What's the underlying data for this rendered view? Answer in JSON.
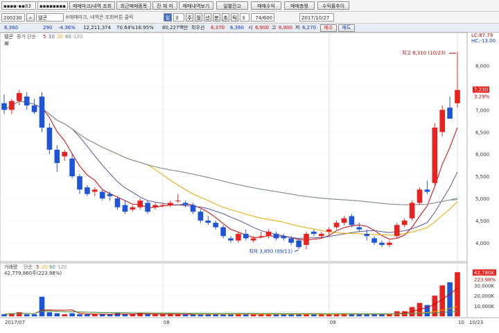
{
  "toolbar": {
    "account": "▪▪▪▪-▪▪83",
    "password": "▪▪▪▪▪▪▪▪",
    "buy_sell_btn": "매매마크/내역 조회",
    "recent_btn": "최근매매종목",
    "balance_btn": "잔 체 미",
    "history_btn": "매매내역보기",
    "daily_balance_btn": "일별잔고",
    "profit_btn": "매매수익",
    "trade_amount_btn": "매매총평",
    "yield_btn": "수익률추이"
  },
  "toolbar2": {
    "code": "200230",
    "search_icon": "search-icon",
    "stock_name": "텔콘",
    "hint": "※매매마크, 내역은 조회버튼 클릭",
    "period_select": "일",
    "period_value": "3",
    "periods": [
      "주",
      "월",
      "년",
      "분",
      "초",
      "틱"
    ],
    "interval": "3",
    "count": "74/600",
    "date": "2017/10/27"
  },
  "quote": {
    "price": "6,360",
    "change": "290",
    "change_pct": "-4.36%",
    "volume": "12,211,374",
    "vol_ratio": "70.64%",
    "turnover": "16.95%",
    "amount": "80,227백만",
    "broker": "최우선",
    "open_label": "6,370",
    "bid": "6,360",
    "open_tag": "시",
    "open": "6,900",
    "high_tag": "고",
    "high": "6,900",
    "low_tag": "저",
    "low": "6,270",
    "buy_btn": "매수",
    "sell_btn": "매도"
  },
  "price_panel": {
    "legend_name": "텔콘",
    "legend_ma": "종가 단순",
    "ma_periods": [
      "5",
      "10",
      "20",
      "60",
      "120"
    ],
    "ma_colors": [
      "#cc0000",
      "#555599",
      "#e8a800",
      "#3c8d5c",
      "#8f8f8f"
    ],
    "lc_label": "LC:87.79",
    "hc_label": "HC:-13.00",
    "high_annotation": "최고 8,310 (10/23)",
    "low_annotation": "최저 3,850 (09/11)",
    "current_price_tag": "7,230",
    "current_pct_tag": "3.29%",
    "y_ticks": [
      "8,000",
      "7,500",
      "7,000",
      "6,500",
      "6,000",
      "5,500",
      "5,000",
      "4,500",
      "4,000"
    ]
  },
  "volume_panel": {
    "legend_name": "거래량",
    "legend_ma": "단순",
    "ma_periods": [
      "5",
      "20",
      "60",
      "120"
    ],
    "value_text": "42,779,860주(223.98%)",
    "current_tag": "42,780K",
    "current_pct": "223.98%",
    "y_ticks": [
      "30,000K",
      "20,000K",
      "10,000K"
    ]
  },
  "x_axis": {
    "labels": [
      "2017/07",
      "08",
      "09",
      "10",
      "10/23"
    ]
  },
  "chart_data": {
    "type": "candlestick",
    "title": "텔콘",
    "x": [
      "2017/07",
      "08",
      "09",
      "10",
      "10/23"
    ],
    "ylim": [
      3700,
      8400
    ],
    "ohlc": [
      [
        7150,
        7350,
        6900,
        7000
      ],
      [
        7000,
        7250,
        6900,
        7200
      ],
      [
        7200,
        7450,
        7100,
        7380
      ],
      [
        7300,
        7400,
        7000,
        7100
      ],
      [
        7100,
        7250,
        6900,
        6950
      ],
      [
        7300,
        7400,
        6500,
        6600
      ],
      [
        6600,
        6700,
        6000,
        6100
      ],
      [
        6100,
        6200,
        5600,
        5800
      ],
      [
        5950,
        6100,
        5850,
        6050
      ],
      [
        5900,
        6000,
        5450,
        5500
      ],
      [
        5500,
        5550,
        5100,
        5200
      ],
      [
        5250,
        5300,
        5050,
        5100
      ],
      [
        5150,
        5250,
        5050,
        5200
      ],
      [
        5150,
        5200,
        4950,
        5000
      ],
      [
        5100,
        5150,
        4950,
        5050
      ],
      [
        5000,
        5050,
        4750,
        4800
      ],
      [
        4850,
        4950,
        4650,
        4700
      ],
      [
        4750,
        4850,
        4700,
        4800
      ],
      [
        4800,
        5000,
        4750,
        4950
      ],
      [
        4900,
        4950,
        4650,
        4700
      ],
      [
        4800,
        4900,
        4750,
        4850
      ],
      [
        4850,
        4900,
        4800,
        4850
      ],
      [
        4850,
        4950,
        4800,
        4900
      ],
      [
        4950,
        5100,
        4900,
        4950
      ],
      [
        4900,
        4950,
        4800,
        4850
      ],
      [
        4850,
        4900,
        4650,
        4700
      ],
      [
        4700,
        4750,
        4450,
        4500
      ],
      [
        4500,
        4600,
        4400,
        4450
      ],
      [
        4450,
        4500,
        4300,
        4350
      ],
      [
        4350,
        4400,
        4100,
        4150
      ],
      [
        4100,
        4150,
        4000,
        4050
      ],
      [
        4050,
        4250,
        4000,
        4200
      ],
      [
        4200,
        4300,
        4050,
        4100
      ],
      [
        4050,
        4150,
        4000,
        4100
      ],
      [
        4150,
        4250,
        4100,
        4150
      ],
      [
        4150,
        4300,
        4100,
        4250
      ],
      [
        4200,
        4250,
        4050,
        4100
      ],
      [
        4150,
        4200,
        4050,
        4100
      ],
      [
        4100,
        4150,
        3950,
        4000
      ],
      [
        4050,
        4100,
        3850,
        3900
      ],
      [
        3950,
        4250,
        3850,
        4200
      ],
      [
        4250,
        4300,
        4150,
        4200
      ],
      [
        4150,
        4250,
        4100,
        4200
      ],
      [
        4250,
        4350,
        4150,
        4300
      ],
      [
        4350,
        4500,
        4300,
        4450
      ],
      [
        4450,
        4600,
        4400,
        4550
      ],
      [
        4600,
        4650,
        4350,
        4400
      ],
      [
        4350,
        4450,
        4250,
        4300
      ],
      [
        4200,
        4300,
        4050,
        4150
      ],
      [
        4100,
        4150,
        3950,
        4000
      ],
      [
        4000,
        4050,
        3900,
        3950
      ],
      [
        3950,
        4050,
        3900,
        4000
      ],
      [
        4150,
        4450,
        4100,
        4400
      ],
      [
        4400,
        4550,
        4350,
        4500
      ],
      [
        4550,
        4950,
        4500,
        4900
      ],
      [
        4900,
        5250,
        4850,
        5200
      ],
      [
        5200,
        5400,
        5100,
        5150
      ],
      [
        5350,
        6700,
        5300,
        6600
      ],
      [
        6500,
        7100,
        6400,
        7000
      ],
      [
        7050,
        7300,
        6900,
        6800
      ],
      [
        7150,
        8310,
        7050,
        7450
      ]
    ],
    "volume_k": [
      2000,
      3000,
      4000,
      2000,
      2000,
      19000,
      4000,
      3000,
      2000,
      3000,
      2000,
      2000,
      2000,
      2000,
      2000,
      3000,
      2000,
      2000,
      3000,
      2000,
      2000,
      2000,
      2000,
      2000,
      2000,
      2000,
      2000,
      2000,
      2000,
      2000,
      2000,
      3000,
      2000,
      2000,
      2000,
      2000,
      2000,
      2000,
      2000,
      2000,
      3000,
      2000,
      2000,
      2000,
      2000,
      3000,
      2000,
      2000,
      2000,
      2000,
      2000,
      2000,
      5000,
      5000,
      9000,
      13000,
      11000,
      20000,
      30000,
      33000,
      42780
    ]
  }
}
